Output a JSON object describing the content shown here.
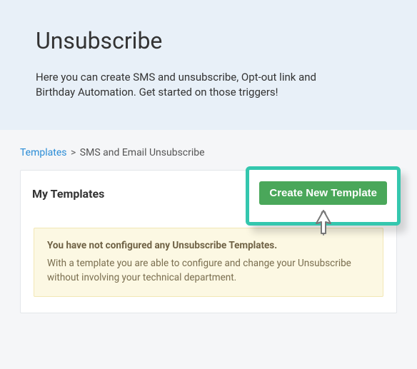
{
  "hero": {
    "title": "Unsubscribe",
    "description": "Here you can create SMS and unsubscribe, Opt-out link and Birthday Automation. Get started on those triggers!"
  },
  "breadcrumb": {
    "root_label": "Templates",
    "separator": ">",
    "current_label": "SMS and Email Unsubscribe"
  },
  "card": {
    "heading": "My Templates",
    "create_button_label": "Create New Template"
  },
  "alert": {
    "title": "You have not configured any Unsubscribe Templates.",
    "body": "With a template you are able to configure and change your Unsubscribe without involving your technical department."
  }
}
